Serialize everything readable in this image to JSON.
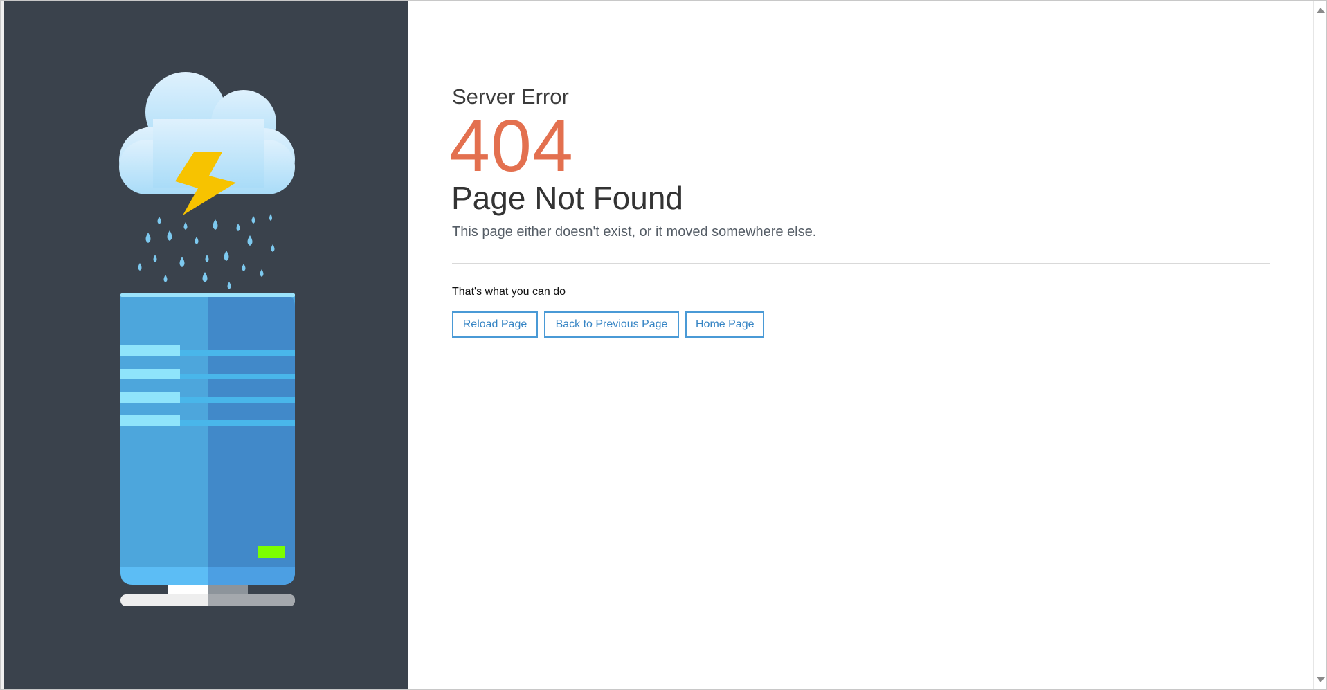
{
  "error": {
    "subtitle": "Server Error",
    "code": "404",
    "title": "Page Not Found",
    "description": "This page either doesn't exist, or it moved somewhere else."
  },
  "actions": {
    "label": "That's what you can do",
    "reload_label": "Reload Page",
    "back_label": "Back to Previous Page",
    "home_label": "Home Page"
  },
  "colors": {
    "panel_background": "#3a424c",
    "accent_code": "#e3704f",
    "button_border": "#4a9ad6",
    "server_body": "#4da6dc",
    "cloud": "#c6e6fa",
    "lightning": "#f7c300",
    "status_led": "#7cff00"
  },
  "icons": {
    "illustration": "cloud-lightning-server-illustration",
    "scroll_up": "scroll-up-arrow-icon",
    "scroll_down": "scroll-down-arrow-icon"
  }
}
